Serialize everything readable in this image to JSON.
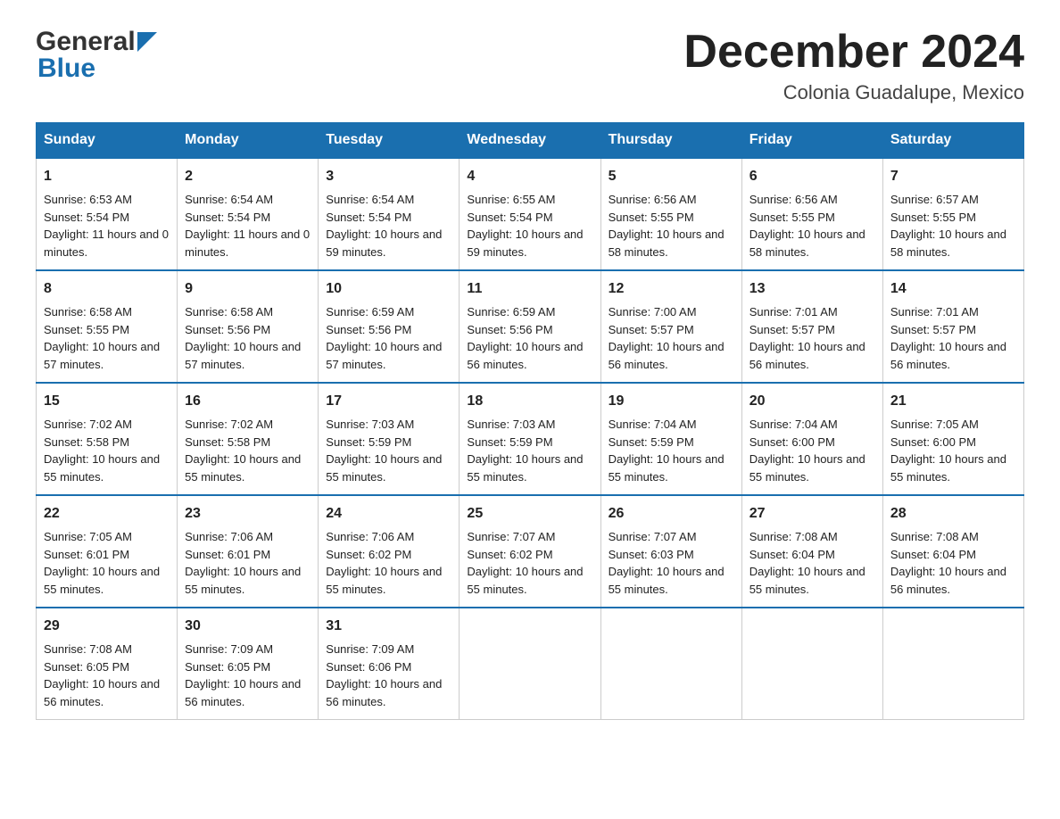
{
  "header": {
    "logo_general": "General",
    "logo_blue": "Blue",
    "month_year": "December 2024",
    "location": "Colonia Guadalupe, Mexico"
  },
  "days_of_week": [
    "Sunday",
    "Monday",
    "Tuesday",
    "Wednesday",
    "Thursday",
    "Friday",
    "Saturday"
  ],
  "weeks": [
    [
      {
        "day": "1",
        "sunrise": "6:53 AM",
        "sunset": "5:54 PM",
        "daylight": "11 hours and 0 minutes."
      },
      {
        "day": "2",
        "sunrise": "6:54 AM",
        "sunset": "5:54 PM",
        "daylight": "11 hours and 0 minutes."
      },
      {
        "day": "3",
        "sunrise": "6:54 AM",
        "sunset": "5:54 PM",
        "daylight": "10 hours and 59 minutes."
      },
      {
        "day": "4",
        "sunrise": "6:55 AM",
        "sunset": "5:54 PM",
        "daylight": "10 hours and 59 minutes."
      },
      {
        "day": "5",
        "sunrise": "6:56 AM",
        "sunset": "5:55 PM",
        "daylight": "10 hours and 58 minutes."
      },
      {
        "day": "6",
        "sunrise": "6:56 AM",
        "sunset": "5:55 PM",
        "daylight": "10 hours and 58 minutes."
      },
      {
        "day": "7",
        "sunrise": "6:57 AM",
        "sunset": "5:55 PM",
        "daylight": "10 hours and 58 minutes."
      }
    ],
    [
      {
        "day": "8",
        "sunrise": "6:58 AM",
        "sunset": "5:55 PM",
        "daylight": "10 hours and 57 minutes."
      },
      {
        "day": "9",
        "sunrise": "6:58 AM",
        "sunset": "5:56 PM",
        "daylight": "10 hours and 57 minutes."
      },
      {
        "day": "10",
        "sunrise": "6:59 AM",
        "sunset": "5:56 PM",
        "daylight": "10 hours and 57 minutes."
      },
      {
        "day": "11",
        "sunrise": "6:59 AM",
        "sunset": "5:56 PM",
        "daylight": "10 hours and 56 minutes."
      },
      {
        "day": "12",
        "sunrise": "7:00 AM",
        "sunset": "5:57 PM",
        "daylight": "10 hours and 56 minutes."
      },
      {
        "day": "13",
        "sunrise": "7:01 AM",
        "sunset": "5:57 PM",
        "daylight": "10 hours and 56 minutes."
      },
      {
        "day": "14",
        "sunrise": "7:01 AM",
        "sunset": "5:57 PM",
        "daylight": "10 hours and 56 minutes."
      }
    ],
    [
      {
        "day": "15",
        "sunrise": "7:02 AM",
        "sunset": "5:58 PM",
        "daylight": "10 hours and 55 minutes."
      },
      {
        "day": "16",
        "sunrise": "7:02 AM",
        "sunset": "5:58 PM",
        "daylight": "10 hours and 55 minutes."
      },
      {
        "day": "17",
        "sunrise": "7:03 AM",
        "sunset": "5:59 PM",
        "daylight": "10 hours and 55 minutes."
      },
      {
        "day": "18",
        "sunrise": "7:03 AM",
        "sunset": "5:59 PM",
        "daylight": "10 hours and 55 minutes."
      },
      {
        "day": "19",
        "sunrise": "7:04 AM",
        "sunset": "5:59 PM",
        "daylight": "10 hours and 55 minutes."
      },
      {
        "day": "20",
        "sunrise": "7:04 AM",
        "sunset": "6:00 PM",
        "daylight": "10 hours and 55 minutes."
      },
      {
        "day": "21",
        "sunrise": "7:05 AM",
        "sunset": "6:00 PM",
        "daylight": "10 hours and 55 minutes."
      }
    ],
    [
      {
        "day": "22",
        "sunrise": "7:05 AM",
        "sunset": "6:01 PM",
        "daylight": "10 hours and 55 minutes."
      },
      {
        "day": "23",
        "sunrise": "7:06 AM",
        "sunset": "6:01 PM",
        "daylight": "10 hours and 55 minutes."
      },
      {
        "day": "24",
        "sunrise": "7:06 AM",
        "sunset": "6:02 PM",
        "daylight": "10 hours and 55 minutes."
      },
      {
        "day": "25",
        "sunrise": "7:07 AM",
        "sunset": "6:02 PM",
        "daylight": "10 hours and 55 minutes."
      },
      {
        "day": "26",
        "sunrise": "7:07 AM",
        "sunset": "6:03 PM",
        "daylight": "10 hours and 55 minutes."
      },
      {
        "day": "27",
        "sunrise": "7:08 AM",
        "sunset": "6:04 PM",
        "daylight": "10 hours and 55 minutes."
      },
      {
        "day": "28",
        "sunrise": "7:08 AM",
        "sunset": "6:04 PM",
        "daylight": "10 hours and 56 minutes."
      }
    ],
    [
      {
        "day": "29",
        "sunrise": "7:08 AM",
        "sunset": "6:05 PM",
        "daylight": "10 hours and 56 minutes."
      },
      {
        "day": "30",
        "sunrise": "7:09 AM",
        "sunset": "6:05 PM",
        "daylight": "10 hours and 56 minutes."
      },
      {
        "day": "31",
        "sunrise": "7:09 AM",
        "sunset": "6:06 PM",
        "daylight": "10 hours and 56 minutes."
      },
      null,
      null,
      null,
      null
    ]
  ]
}
